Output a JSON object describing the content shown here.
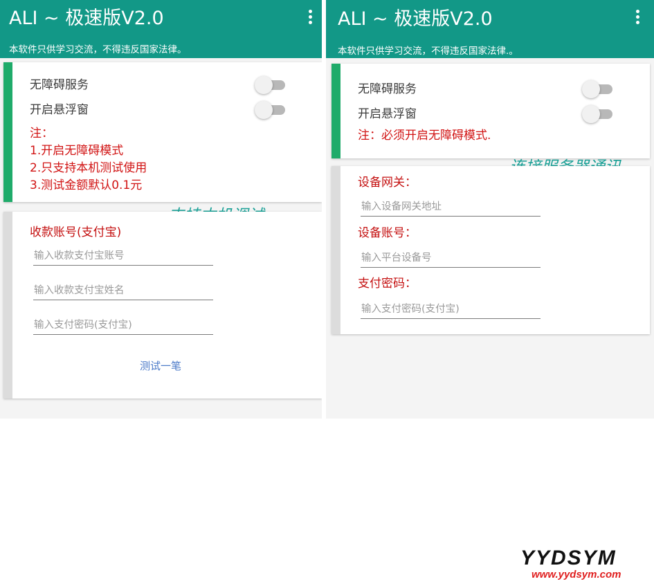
{
  "left": {
    "title": "ALI ~ 极速版V2.0",
    "subtitle": "本软件只供学习交流，不得违反国家法律。",
    "toggles": [
      {
        "label": "无障碍服务",
        "on": false
      },
      {
        "label": "开启悬浮窗",
        "on": false
      }
    ],
    "note_title": "注：",
    "notes": [
      "1.开启无障碍模式",
      "2.只支持本机测试使用",
      "3.测试金额默认0.1元"
    ],
    "payee_heading": "收款账号(支付宝)",
    "inputs": [
      {
        "placeholder": "输入收款支付宝账号",
        "value": ""
      },
      {
        "placeholder": "输入收款支付宝姓名",
        "value": ""
      },
      {
        "placeholder": "输入支付密码(支付宝)",
        "value": ""
      }
    ],
    "test_button": "测试一笔",
    "annotation": "支持本机调试"
  },
  "right": {
    "title": "ALI ~ 极速版V2.0",
    "subtitle": "本软件只供学习交流，不得违反国家法律.。",
    "toggles": [
      {
        "label": "无障碍服务",
        "on": false
      },
      {
        "label": "开启悬浮窗",
        "on": false
      }
    ],
    "note": "注：必须开启无障碍模式.",
    "annotation": "连接服务器通讯",
    "fields": [
      {
        "label": "设备网关：",
        "placeholder": "输入设备网关地址",
        "value": ""
      },
      {
        "label": "设备账号：",
        "placeholder": "输入平台设备号",
        "value": ""
      },
      {
        "label": "支付密码：",
        "placeholder": "输入支付密码(支付宝)",
        "value": ""
      }
    ]
  },
  "watermark": {
    "logo": "YYDSYM",
    "url": "www.yydsym.com"
  },
  "colors": {
    "appbar": "#129887",
    "accent_green": "#1fab6a",
    "note_red": "#d11313",
    "annotation": "#1aa096",
    "link": "#4a79c8"
  }
}
